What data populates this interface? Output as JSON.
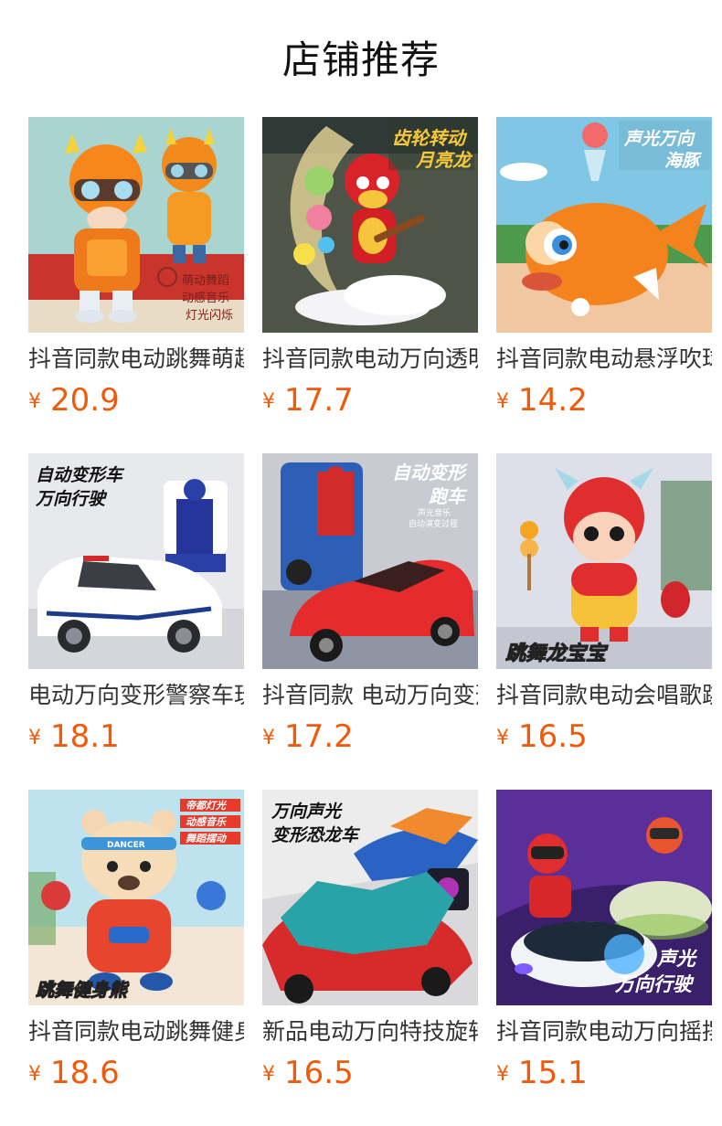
{
  "page_title": "店铺推荐",
  "currency_symbol": "¥",
  "products": [
    {
      "name": "抖音同款电动跳舞萌趣小龙",
      "price": "20.9",
      "image_text": [
        "萌动舞蹈",
        "动感音乐",
        "灯光闪烁"
      ],
      "icon": "dancing-dragon-toy-image"
    },
    {
      "name": "抖音同款电动万向透明齿轮",
      "price": "17.7",
      "image_text": [
        "齿轮转动",
        "月亮龙"
      ],
      "icon": "gear-moon-dragon-toy-image"
    },
    {
      "name": "抖音同款电动悬浮吹球海豚",
      "price": "14.2",
      "image_text": [
        "声光万向",
        "海豚"
      ],
      "icon": "floating-ball-dolphin-toy-image"
    },
    {
      "name": "电动万向变形警察车玩具",
      "price": "18.1",
      "image_text": [
        "自动变形车",
        "万向行驶"
      ],
      "icon": "transforming-police-car-image"
    },
    {
      "name": "抖音同款 电动万向变形跑车",
      "price": "17.2",
      "image_text": [
        "自动变形",
        "跑车",
        "声光音乐",
        "自动演变过程"
      ],
      "icon": "transforming-sports-car-image"
    },
    {
      "name": "抖音同款电动会唱歌跳舞",
      "price": "16.5",
      "image_text": [
        "跳舞龙宝宝"
      ],
      "icon": "dancing-baby-dragon-image"
    },
    {
      "name": "抖音同款电动跳舞健身熊",
      "price": "18.6",
      "image_text": [
        "帝都灯光",
        "动感音乐",
        "舞蹈摆动",
        "跳舞健身熊",
        "DANCER"
      ],
      "icon": "dancing-fitness-bear-image"
    },
    {
      "name": "新品电动万向特技旋转",
      "price": "16.5",
      "image_text": [
        "万向声光",
        "变形恐龙车"
      ],
      "icon": "dinosaur-car-image"
    },
    {
      "name": "抖音同款电动万向摇摆",
      "price": "15.1",
      "image_text": [
        "声光",
        "万向行驶"
      ],
      "icon": "dj-car-toy-image"
    }
  ]
}
